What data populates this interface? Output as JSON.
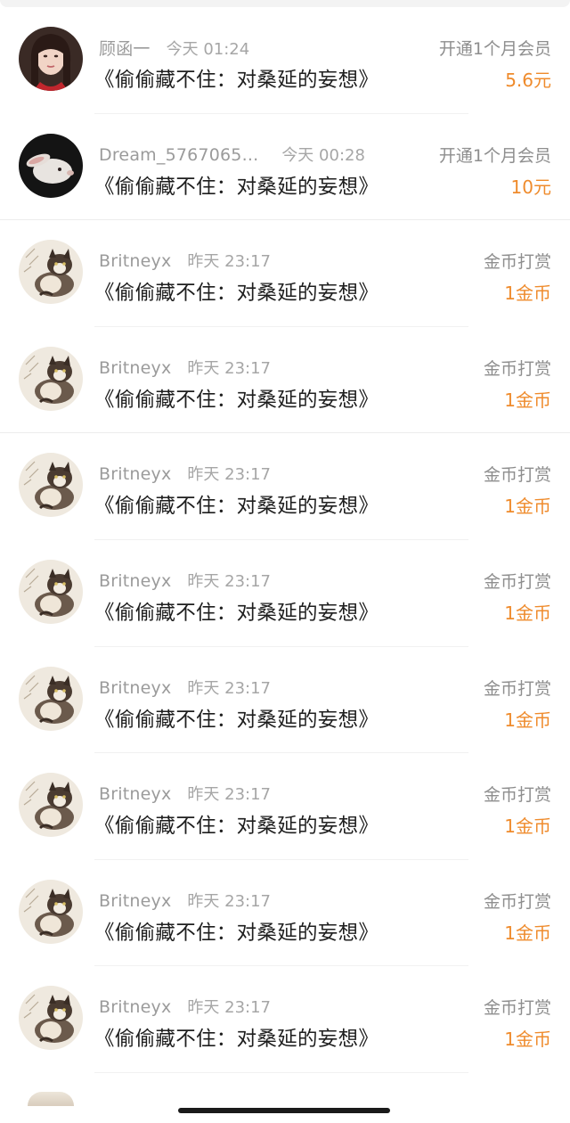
{
  "colors": {
    "amount": "#ef8b2c",
    "secondary_text": "#9b9b9b",
    "primary_text": "#1e1e1e"
  },
  "records": [
    {
      "name": "顾函一",
      "time": "今天 01:24",
      "title": "《偷偷藏不住：对桑延的妄想》",
      "kind": "开通1个月会员",
      "amount": "5.6元",
      "avatar": "girl-portrait-avatar"
    },
    {
      "name": "Dream_5767065...",
      "time": "今天 00:28",
      "title": "《偷偷藏不住：对桑延的妄想》",
      "kind": "开通1个月会员",
      "amount": "10元",
      "avatar": "white-rabbit-avatar"
    },
    {
      "name": "Britneyx",
      "time": "昨天 23:17",
      "title": "《偷偷藏不住：对桑延的妄想》",
      "kind": "金币打赏",
      "amount": "1金币",
      "avatar": "cat-avatar"
    },
    {
      "name": "Britneyx",
      "time": "昨天 23:17",
      "title": "《偷偷藏不住：对桑延的妄想》",
      "kind": "金币打赏",
      "amount": "1金币",
      "avatar": "cat-avatar"
    },
    {
      "name": "Britneyx",
      "time": "昨天 23:17",
      "title": "《偷偷藏不住：对桑延的妄想》",
      "kind": "金币打赏",
      "amount": "1金币",
      "avatar": "cat-avatar"
    },
    {
      "name": "Britneyx",
      "time": "昨天 23:17",
      "title": "《偷偷藏不住：对桑延的妄想》",
      "kind": "金币打赏",
      "amount": "1金币",
      "avatar": "cat-avatar"
    },
    {
      "name": "Britneyx",
      "time": "昨天 23:17",
      "title": "《偷偷藏不住：对桑延的妄想》",
      "kind": "金币打赏",
      "amount": "1金币",
      "avatar": "cat-avatar"
    },
    {
      "name": "Britneyx",
      "time": "昨天 23:17",
      "title": "《偷偷藏不住：对桑延的妄想》",
      "kind": "金币打赏",
      "amount": "1金币",
      "avatar": "cat-avatar"
    },
    {
      "name": "Britneyx",
      "time": "昨天 23:17",
      "title": "《偷偷藏不住：对桑延的妄想》",
      "kind": "金币打赏",
      "amount": "1金币",
      "avatar": "cat-avatar"
    },
    {
      "name": "Britneyx",
      "time": "昨天 23:17",
      "title": "《偷偷藏不住：对桑延的妄想》",
      "kind": "金币打赏",
      "amount": "1金币",
      "avatar": "cat-avatar"
    }
  ]
}
